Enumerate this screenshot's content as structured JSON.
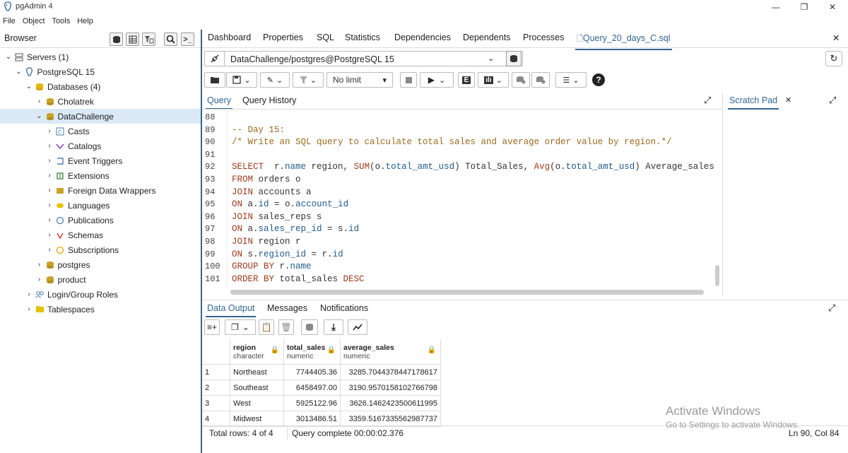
{
  "app": {
    "title": "pgAdmin 4"
  },
  "menu": [
    "File",
    "Object",
    "Tools",
    "Help"
  ],
  "browser": {
    "label": "Browser",
    "tree": [
      {
        "label": "Servers (1)",
        "depth": 0,
        "expanded": true,
        "icon": "servers-icon"
      },
      {
        "label": "PostgreSQL 15",
        "depth": 1,
        "expanded": true,
        "icon": "elephant-icon"
      },
      {
        "label": "Databases (4)",
        "depth": 2,
        "expanded": true,
        "icon": "databases-icon"
      },
      {
        "label": "Cholatrek",
        "depth": 3,
        "expanded": false,
        "icon": "database-icon"
      },
      {
        "label": "DataChallenge",
        "depth": 3,
        "expanded": true,
        "icon": "database-icon",
        "selected": true
      },
      {
        "label": "Casts",
        "depth": 4,
        "expanded": false,
        "icon": "casts-icon"
      },
      {
        "label": "Catalogs",
        "depth": 4,
        "expanded": false,
        "icon": "catalogs-icon"
      },
      {
        "label": "Event Triggers",
        "depth": 4,
        "expanded": false,
        "icon": "event-triggers-icon"
      },
      {
        "label": "Extensions",
        "depth": 4,
        "expanded": false,
        "icon": "extensions-icon"
      },
      {
        "label": "Foreign Data Wrappers",
        "depth": 4,
        "expanded": false,
        "icon": "fdw-icon"
      },
      {
        "label": "Languages",
        "depth": 4,
        "expanded": false,
        "icon": "languages-icon"
      },
      {
        "label": "Publications",
        "depth": 4,
        "expanded": false,
        "icon": "publications-icon"
      },
      {
        "label": "Schemas",
        "depth": 4,
        "expanded": false,
        "icon": "schemas-icon"
      },
      {
        "label": "Subscriptions",
        "depth": 4,
        "expanded": false,
        "icon": "subscriptions-icon"
      },
      {
        "label": "postgres",
        "depth": 3,
        "expanded": false,
        "icon": "database-icon"
      },
      {
        "label": "product",
        "depth": 3,
        "expanded": false,
        "icon": "database-icon"
      },
      {
        "label": "Login/Group Roles",
        "depth": 2,
        "expanded": false,
        "icon": "roles-icon"
      },
      {
        "label": "Tablespaces",
        "depth": 2,
        "expanded": false,
        "icon": "tablespaces-icon"
      }
    ]
  },
  "tabs": [
    "Dashboard",
    "Properties",
    "SQL",
    "Statistics",
    "Dependencies",
    "Dependents",
    "Processes",
    "Query_20_days_C.sql"
  ],
  "connection": "DataChallenge/postgres@PostgreSQL 15",
  "query_toolbar": {
    "limit": "No limit"
  },
  "query_tabs": [
    "Query",
    "Query History"
  ],
  "scratch_pad": "Scratch Pad",
  "editor": {
    "lines": [
      {
        "n": "88",
        "text": ""
      },
      {
        "n": "89",
        "text": "-- Day 15:"
      },
      {
        "n": "90",
        "text": "/* Write an SQL query to calculate total sales and average order value by region.*/"
      },
      {
        "n": "91",
        "text": ""
      },
      {
        "n": "92",
        "text": "SELECT  r.name region, SUM(o.total_amt_usd) Total_Sales, Avg(o.total_amt_usd) Average_sales"
      },
      {
        "n": "93",
        "text": "FROM orders o"
      },
      {
        "n": "94",
        "text": "JOIN accounts a"
      },
      {
        "n": "95",
        "text": "ON a.id = o.account_id"
      },
      {
        "n": "96",
        "text": "JOIN sales_reps s"
      },
      {
        "n": "97",
        "text": "ON a.sales_rep_id = s.id"
      },
      {
        "n": "98",
        "text": "JOIN region r"
      },
      {
        "n": "99",
        "text": "ON s.region_id = r.id"
      },
      {
        "n": "100",
        "text": "GROUP BY r.name"
      },
      {
        "n": "101",
        "text": "ORDER BY total_sales DESC"
      }
    ]
  },
  "result_tabs": [
    "Data Output",
    "Messages",
    "Notifications"
  ],
  "grid": {
    "columns": [
      {
        "name": "region",
        "type": "character"
      },
      {
        "name": "total_sales",
        "type": "numeric"
      },
      {
        "name": "average_sales",
        "type": "numeric"
      }
    ],
    "rows": [
      [
        "1",
        "Northeast",
        "7744405.36",
        "3285.7044378447178617"
      ],
      [
        "2",
        "Southeast",
        "6458497.00",
        "3190.9570158102766798"
      ],
      [
        "3",
        "West",
        "5925122.96",
        "3626.1462423500611995"
      ],
      [
        "4",
        "Midwest",
        "3013486.51",
        "3359.5167335562987737"
      ]
    ]
  },
  "status": {
    "rows": "Total rows: 4 of 4",
    "query": "Query complete 00:00:02.376",
    "cursor": "Ln 90, Col 84"
  },
  "watermark": {
    "line1": "Activate Windows",
    "line2": "Go to Settings to activate Windows."
  }
}
